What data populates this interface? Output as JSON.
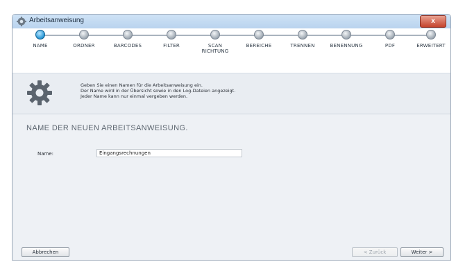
{
  "window": {
    "title": "Arbeitsanweisung",
    "close_label": "x"
  },
  "steps": [
    {
      "label": "NAME",
      "active": true
    },
    {
      "label": "ORDNER",
      "active": false
    },
    {
      "label": "BARCODES",
      "active": false
    },
    {
      "label": "FILTER",
      "active": false
    },
    {
      "label": "SCAN RICHTUNG",
      "active": false
    },
    {
      "label": "BEREICHE",
      "active": false
    },
    {
      "label": "TRENNEN",
      "active": false
    },
    {
      "label": "BENENNUNG",
      "active": false
    },
    {
      "label": "PDF",
      "active": false
    },
    {
      "label": "ERWEITERT",
      "active": false
    }
  ],
  "info": {
    "lines": [
      "Geben Sie einen Namen für die Arbeitsanweisung ein.",
      "Der Name wird in der Übersicht sowie in den Log-Dateien angezeigt.",
      "Jeder Name kann nur einmal vergeben werden."
    ]
  },
  "section": {
    "title": "NAME DER NEUEN ARBEITSANWEISUNG."
  },
  "form": {
    "name_label": "Name:",
    "name_value": "Eingangsrechnungen"
  },
  "buttons": {
    "cancel": "Abbrechen",
    "back": "< Zurück",
    "next": "Weiter >"
  },
  "colors": {
    "active_step": "#2f9bd8",
    "titlebar": "#b9d3ee",
    "close": "#c4432d"
  }
}
